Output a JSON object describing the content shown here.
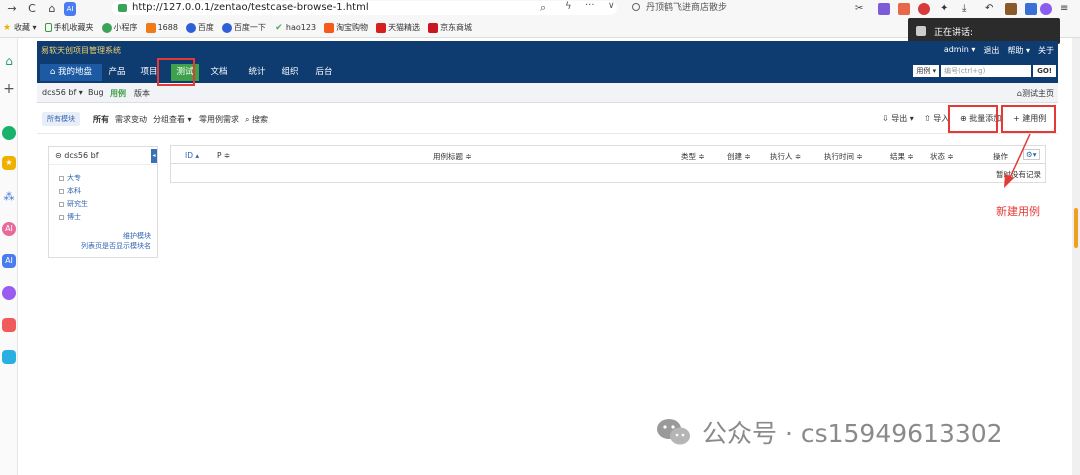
{
  "browser": {
    "url": "http://127.0.0.1/zentao/testcase-browse-1.html",
    "search_text": "丹顶鹤飞进商店散步",
    "bookmarks": [
      "收藏",
      "手机收藏夹",
      "小程序",
      "1688",
      "百度",
      "百度一下",
      "hao123",
      "淘宝购物",
      "天猫精选",
      "京东商城"
    ],
    "talk_popup": "正在讲话:"
  },
  "app": {
    "title": "易软天创项目管理系统",
    "user_nav": [
      "admin ▾",
      "退出",
      "帮助 ▾",
      "关于"
    ],
    "main_tabs": [
      "我的地盘",
      "产品",
      "项目",
      "测试",
      "文档",
      "统计",
      "组织",
      "后台"
    ],
    "search": {
      "type": "用例 ▾",
      "placeholder": "编号(ctrl+g)",
      "go": "GO!"
    }
  },
  "subnav": {
    "product": "dcs56 bf ▾",
    "items": [
      "Bug",
      "用例",
      "版本"
    ],
    "home": "测试主页"
  },
  "featbar": {
    "module": "所有模块",
    "filters": [
      "所有",
      "需求变动",
      "分组查看 ▾",
      "零用例需求",
      "搜索"
    ],
    "export": "导出 ▾",
    "import": "导入",
    "batch_create": "批量添加",
    "create": "建用例"
  },
  "tree": {
    "product": "dcs56 bf",
    "nodes": [
      "大专",
      "本科",
      "研究生",
      "博士"
    ],
    "manage": "维护模块",
    "show_module": "列表页是否显示模块名"
  },
  "table": {
    "headers": [
      "ID ▴",
      "P ≑",
      "用例标题 ≑",
      "类型 ≑",
      "创建 ≑",
      "执行人 ≑",
      "执行时间 ≑",
      "结果 ≑",
      "状态 ≑",
      "操作"
    ],
    "empty": "暂时没有记录"
  },
  "annotation": "新建用例",
  "watermark": "公众号 · cs15949613302"
}
